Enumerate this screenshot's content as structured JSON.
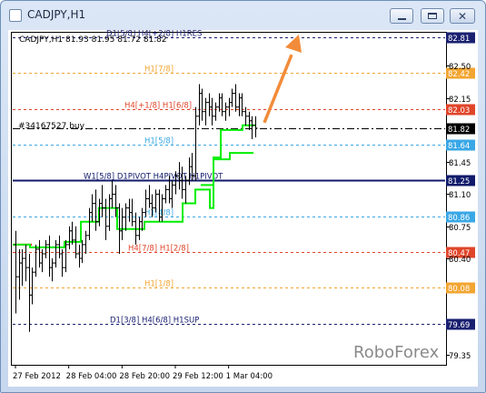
{
  "window": {
    "title": "CADJPY,H1",
    "buttons": [
      "minimize",
      "maximize",
      "close"
    ]
  },
  "chart_info": {
    "symbol_line": "CADJPY,H1   81.93 81.95 81.72 81.82",
    "trade_label": "#34167527 buy",
    "watermark": "RoboForex"
  },
  "levels": [
    {
      "label": "D1[5/8] H4[+2/8] H1RES",
      "price": "82.81",
      "color": "#1a2070"
    },
    {
      "label": "H1[7/8]",
      "price": "82.42",
      "color": "#f2a531"
    },
    {
      "label": "H4[+1/8] H1[6/8]",
      "price": "82.03",
      "color": "#e0452a"
    },
    {
      "label": "",
      "price": "81.82",
      "color": "#000000"
    },
    {
      "label": "H1[5/8]",
      "price": "81.64",
      "color": "#3aa7e6"
    },
    {
      "label": "W1[5/8] D1PIVOT H4PIVOT H1PIVOT",
      "price": "81.25",
      "color": "#101a6a"
    },
    {
      "label": "H1[4/8]",
      "price": "80.86",
      "color": "#3aa7e6"
    },
    {
      "label": "H4[7/8] H1[2/8]",
      "price": "80.47",
      "color": "#e0452a"
    },
    {
      "label": "H1[1/8]",
      "price": "80.08",
      "color": "#f2a531"
    },
    {
      "label": "D1[3/8] H4[6/8] H1SUP",
      "price": "79.69",
      "color": "#1a2070"
    }
  ],
  "price_axis_ticks": [
    "82.50",
    "82.15",
    "81.45",
    "81.10",
    "80.75",
    "80.40",
    "79.35"
  ],
  "time_axis_ticks": [
    "27 Feb 2012",
    "28 Feb 04:00",
    "28 Feb 20:00",
    "29 Feb 12:00",
    "1 Mar 04:00"
  ],
  "colors": {
    "window_frame": "#6f8fb8",
    "bars": "#000000",
    "trend_line": "#00ee00",
    "prior_trend": "#ff0000",
    "arrow": "#f28c3a"
  },
  "chart_data": {
    "type": "ohlc",
    "symbol": "CADJPY",
    "timeframe": "H1",
    "ylim": [
      79.25,
      82.85
    ],
    "ohlc": [
      [
        80.55,
        80.7,
        79.8,
        80.2
      ],
      [
        80.2,
        80.5,
        79.95,
        80.35
      ],
      [
        80.35,
        80.5,
        80.1,
        80.4
      ],
      [
        80.4,
        80.55,
        80.15,
        80.3
      ],
      [
        80.3,
        80.45,
        79.6,
        80.0
      ],
      [
        80.0,
        80.3,
        79.9,
        80.25
      ],
      [
        80.25,
        80.55,
        80.2,
        80.5
      ],
      [
        80.5,
        80.6,
        80.3,
        80.35
      ],
      [
        80.35,
        80.5,
        80.25,
        80.45
      ],
      [
        80.45,
        80.6,
        80.4,
        80.55
      ],
      [
        80.55,
        80.65,
        80.2,
        80.3
      ],
      [
        80.3,
        80.4,
        80.15,
        80.35
      ],
      [
        80.35,
        80.6,
        80.3,
        80.55
      ],
      [
        80.55,
        80.65,
        80.4,
        80.45
      ],
      [
        80.45,
        80.5,
        80.2,
        80.3
      ],
      [
        80.3,
        80.6,
        80.25,
        80.55
      ],
      [
        80.55,
        80.75,
        80.5,
        80.7
      ],
      [
        80.7,
        80.8,
        80.55,
        80.6
      ],
      [
        80.6,
        80.75,
        80.4,
        80.45
      ],
      [
        80.45,
        80.55,
        80.3,
        80.4
      ],
      [
        80.4,
        80.6,
        80.35,
        80.55
      ],
      [
        80.55,
        80.7,
        80.45,
        80.65
      ],
      [
        80.65,
        80.95,
        80.6,
        80.9
      ],
      [
        80.9,
        81.1,
        80.8,
        81.0
      ],
      [
        81.0,
        81.15,
        80.7,
        80.8
      ],
      [
        80.8,
        81.05,
        80.75,
        81.0
      ],
      [
        81.0,
        81.2,
        80.85,
        80.95
      ],
      [
        80.95,
        81.05,
        80.6,
        80.75
      ],
      [
        80.75,
        81.1,
        80.7,
        81.05
      ],
      [
        81.05,
        81.25,
        80.95,
        81.1
      ],
      [
        81.1,
        81.2,
        80.85,
        80.95
      ],
      [
        80.95,
        81.0,
        80.45,
        80.7
      ],
      [
        80.7,
        80.95,
        80.6,
        80.85
      ],
      [
        80.85,
        81.0,
        80.7,
        80.95
      ],
      [
        80.95,
        81.05,
        80.8,
        80.9
      ],
      [
        80.9,
        81.05,
        80.75,
        80.8
      ],
      [
        80.8,
        80.9,
        80.55,
        80.65
      ],
      [
        80.65,
        80.85,
        80.6,
        80.8
      ],
      [
        80.8,
        80.95,
        80.7,
        80.9
      ],
      [
        80.9,
        81.15,
        80.85,
        81.05
      ],
      [
        81.05,
        81.2,
        80.95,
        81.0
      ],
      [
        81.0,
        81.1,
        80.85,
        80.95
      ],
      [
        80.95,
        81.15,
        80.9,
        81.1
      ],
      [
        81.1,
        81.15,
        80.8,
        80.85
      ],
      [
        80.85,
        81.1,
        80.8,
        81.05
      ],
      [
        81.05,
        81.2,
        81.0,
        81.15
      ],
      [
        81.15,
        81.3,
        81.0,
        81.05
      ],
      [
        81.05,
        81.25,
        80.95,
        81.2
      ],
      [
        81.2,
        81.35,
        81.1,
        81.3
      ],
      [
        81.3,
        81.45,
        81.15,
        81.25
      ],
      [
        81.25,
        81.4,
        81.05,
        81.15
      ],
      [
        81.15,
        81.3,
        81.0,
        81.25
      ],
      [
        81.25,
        81.5,
        81.2,
        81.4
      ],
      [
        81.4,
        81.55,
        81.25,
        81.3
      ],
      [
        81.3,
        82.05,
        81.25,
        81.95
      ],
      [
        81.95,
        82.3,
        81.85,
        82.2
      ],
      [
        82.2,
        82.25,
        81.9,
        82.0
      ],
      [
        82.0,
        82.15,
        81.85,
        82.1
      ],
      [
        82.1,
        82.2,
        81.95,
        82.05
      ],
      [
        82.05,
        82.15,
        81.85,
        81.95
      ],
      [
        81.95,
        82.1,
        81.9,
        82.05
      ],
      [
        82.05,
        82.2,
        82.0,
        82.15
      ],
      [
        82.15,
        82.2,
        81.95,
        82.0
      ],
      [
        82.0,
        82.1,
        81.9,
        82.05
      ],
      [
        82.05,
        82.15,
        81.95,
        82.1
      ],
      [
        82.1,
        82.25,
        82.05,
        82.2
      ],
      [
        82.2,
        82.3,
        82.0,
        82.05
      ],
      [
        82.05,
        82.2,
        81.95,
        82.15
      ],
      [
        82.15,
        82.2,
        81.95,
        82.0
      ],
      [
        82.0,
        82.05,
        81.85,
        81.95
      ],
      [
        81.95,
        82.0,
        81.8,
        81.9
      ],
      [
        81.9,
        81.95,
        81.7,
        81.85
      ],
      [
        81.85,
        81.95,
        81.72,
        81.82
      ]
    ]
  }
}
